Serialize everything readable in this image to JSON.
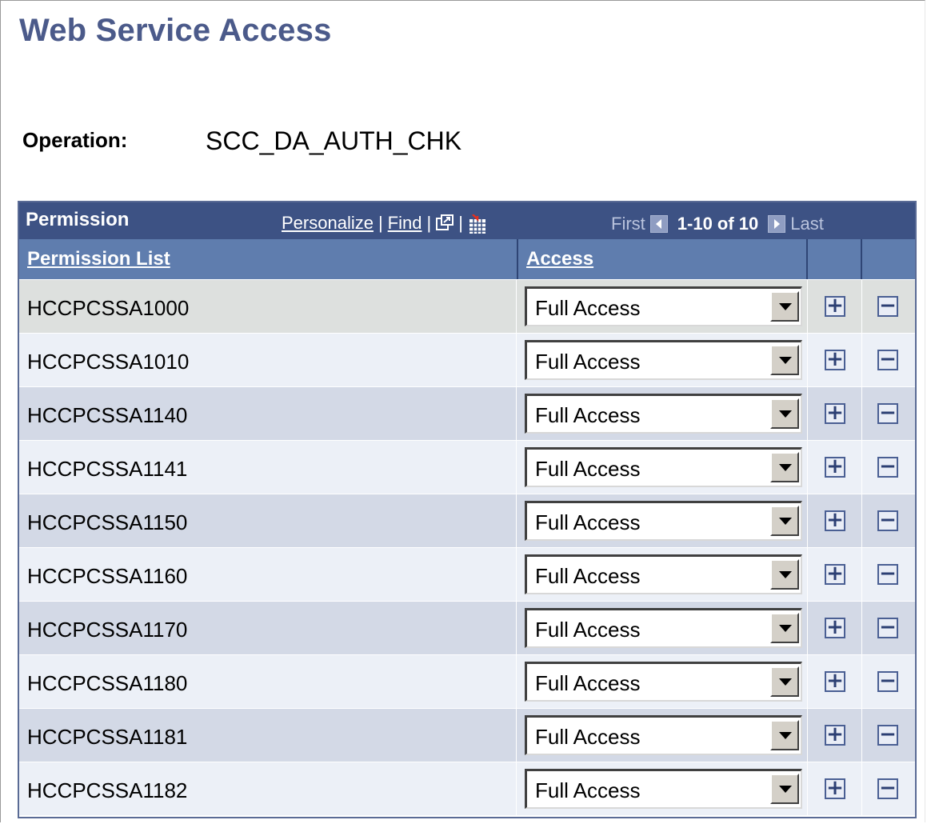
{
  "page": {
    "title": "Web Service Access",
    "operation_label": "Operation:",
    "operation_value": "SCC_DA_AUTH_CHK"
  },
  "grid": {
    "title": "Permission",
    "links": {
      "personalize": "Personalize",
      "find": "Find",
      "separator": "|"
    },
    "pager": {
      "first": "First",
      "range": "1-10 of 10",
      "last": "Last"
    },
    "columns": {
      "permission_list": "Permission List",
      "access": "Access"
    },
    "rows": [
      {
        "permission": "HCCPCSSA1000",
        "access": "Full Access"
      },
      {
        "permission": "HCCPCSSA1010",
        "access": "Full Access"
      },
      {
        "permission": "HCCPCSSA1140",
        "access": "Full Access"
      },
      {
        "permission": "HCCPCSSA1141",
        "access": "Full Access"
      },
      {
        "permission": "HCCPCSSA1150",
        "access": "Full Access"
      },
      {
        "permission": "HCCPCSSA1160",
        "access": "Full Access"
      },
      {
        "permission": "HCCPCSSA1170",
        "access": "Full Access"
      },
      {
        "permission": "HCCPCSSA1180",
        "access": "Full Access"
      },
      {
        "permission": "HCCPCSSA1181",
        "access": "Full Access"
      },
      {
        "permission": "HCCPCSSA1182",
        "access": "Full Access"
      }
    ],
    "add_symbol": "+",
    "remove_symbol": "−"
  },
  "colors": {
    "title": "#4b5a8a",
    "header_bg": "#3d5284",
    "column_header_bg": "#5f7dae",
    "row_selected": "#dde0de",
    "row_even": "#ecf0f7",
    "row_odd": "#d3d9e6"
  },
  "icons": [
    "new-window-icon",
    "download-grid-icon",
    "prev-page-icon",
    "next-page-icon",
    "add-row-icon",
    "delete-row-icon",
    "dropdown-arrow-icon"
  ]
}
